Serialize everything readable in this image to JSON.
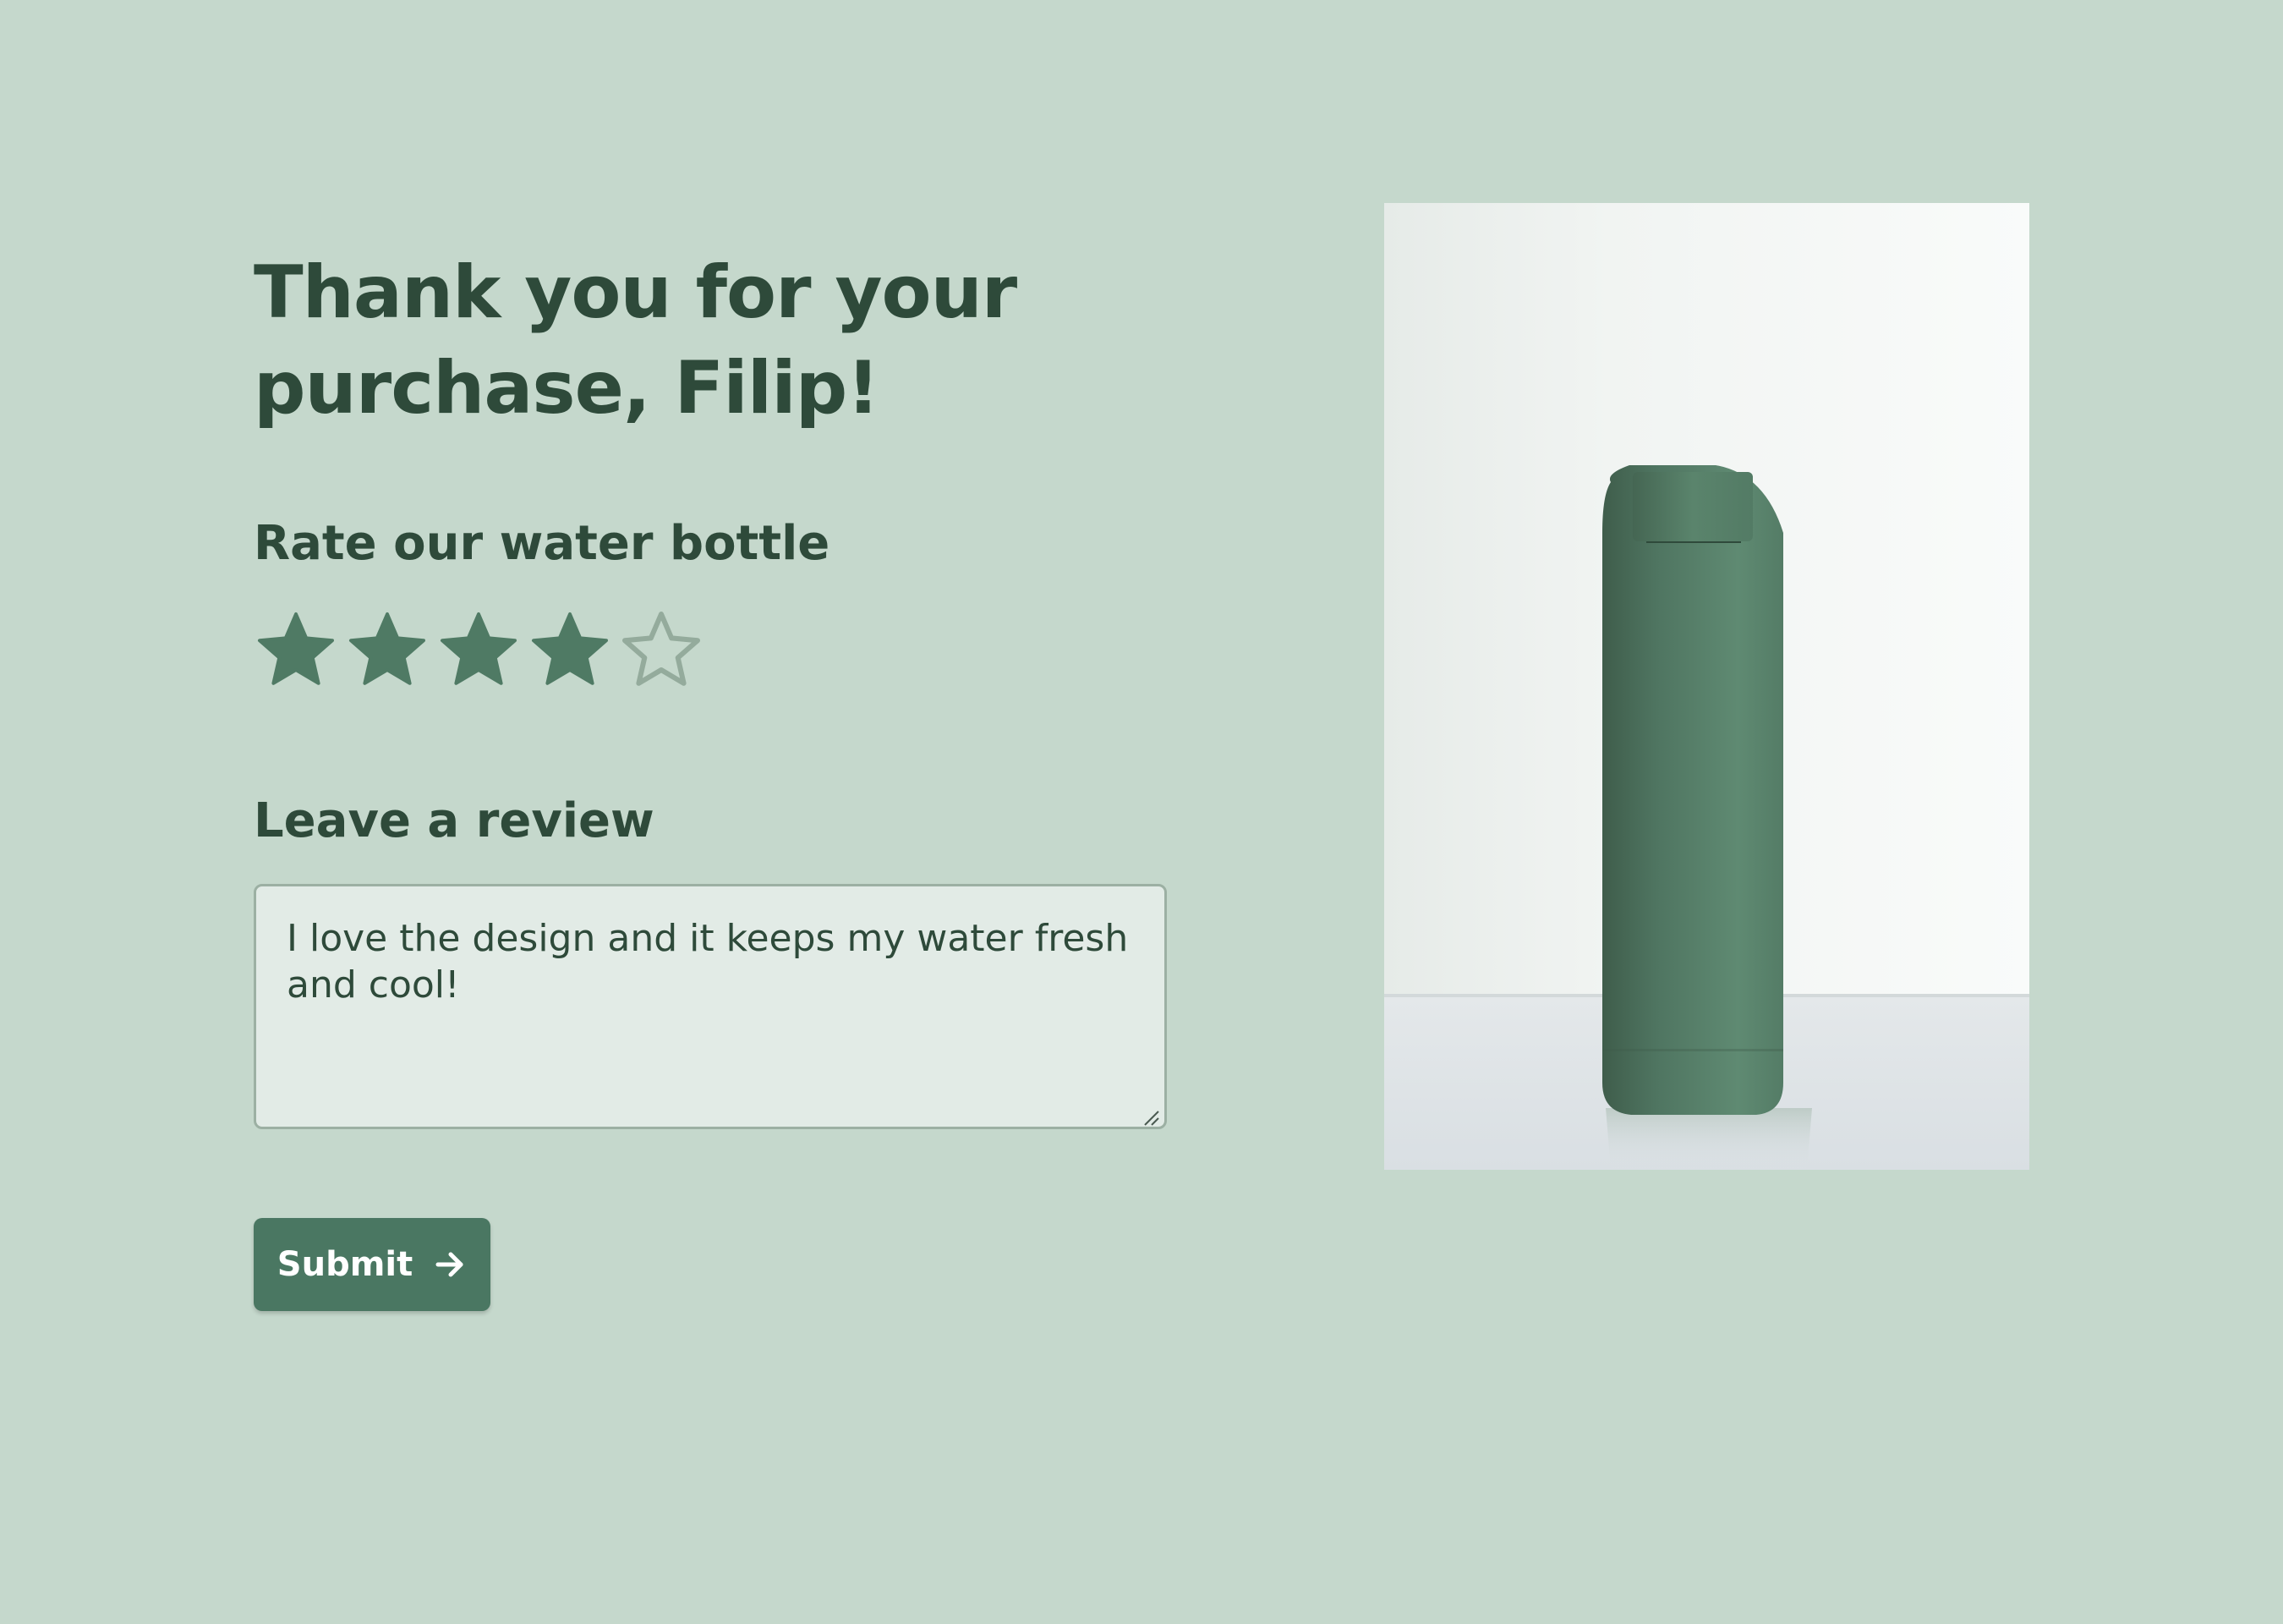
{
  "heading": {
    "line1": "Thank you for your",
    "line2": "purchase, Filip!"
  },
  "rating": {
    "label": "Rate our water bottle",
    "value": 4,
    "max": 5
  },
  "review": {
    "label": "Leave a review",
    "text": "I love the design and it keeps my water fresh and cool!"
  },
  "submit": {
    "label": "Submit",
    "icon": "arrow-right-icon"
  },
  "product_image": {
    "subject": "green-water-bottle"
  },
  "colors": {
    "background": "#c5d8cc",
    "text": "#2e4a3a",
    "accent": "#4a7762",
    "star_filled": "#4f7a64",
    "star_empty_outline": "#94ab9c",
    "textarea_bg": "#e2ebe6"
  }
}
